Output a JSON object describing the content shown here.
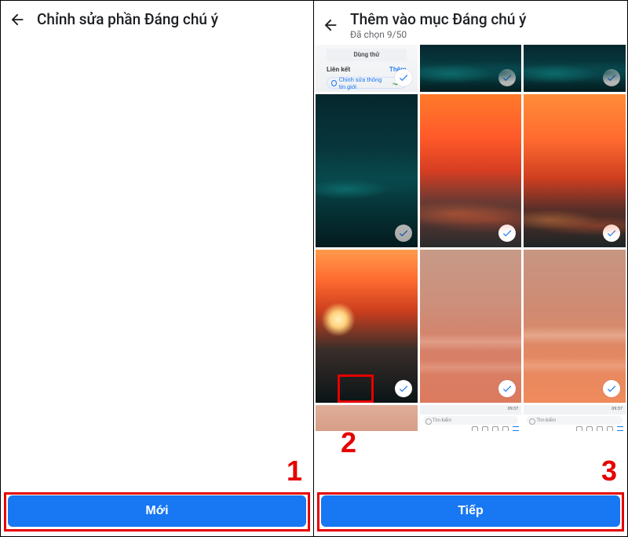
{
  "left": {
    "title": "Chỉnh sửa phần Đáng chú ý",
    "button": "Mới"
  },
  "right": {
    "title": "Thêm vào mục Đáng chú ý",
    "subtitle": "Đã chọn 9/50",
    "button": "Tiếp",
    "tile_ui": {
      "try_btn": "Dùng thử",
      "links_label": "Liên kết",
      "add_label": "Thêm",
      "chip_text": "Chỉnh sửa thông tin giới"
    },
    "tile_browser": {
      "search_placeholder": "Tìm kiếm",
      "time": "09:37"
    },
    "photos": [
      {
        "kind": "ui-screenshot",
        "selected": true
      },
      {
        "kind": "ocean-waves",
        "selected": true
      },
      {
        "kind": "ocean-waves",
        "selected": true
      },
      {
        "kind": "ocean-waves-dark",
        "selected": true
      },
      {
        "kind": "orange-sunset",
        "selected": true
      },
      {
        "kind": "orange-sunset-bokeh",
        "selected": true
      },
      {
        "kind": "sunset-sun-blur",
        "selected": true
      },
      {
        "kind": "dusky-orange-clouds",
        "selected": true
      },
      {
        "kind": "dusky-orange-clouds",
        "selected": true
      },
      {
        "kind": "dusky-slice",
        "selected": false
      },
      {
        "kind": "browser-bottom-slice",
        "selected": false
      },
      {
        "kind": "browser-bottom-slice",
        "selected": false
      }
    ]
  },
  "annotations": {
    "n1": "1",
    "n2": "2",
    "n3": "3"
  }
}
